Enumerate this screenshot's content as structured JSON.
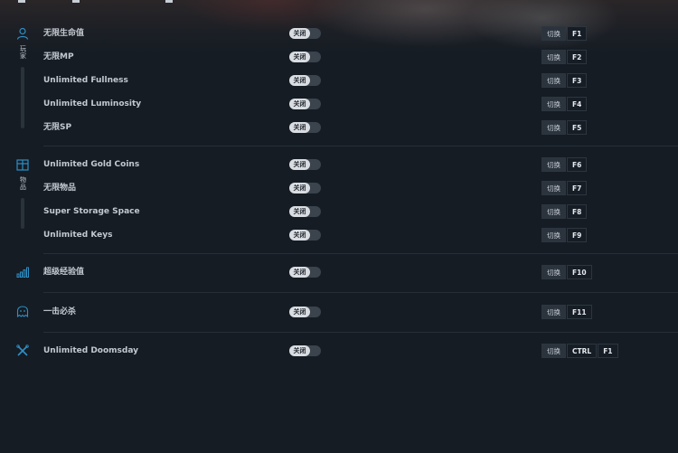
{
  "accent_color": "#2f8fc4",
  "categories": {
    "player": {
      "icon": "person-icon",
      "label": "玩家"
    },
    "inventory": {
      "icon": "box-icon",
      "label": "物品"
    },
    "stats": {
      "icon": "bars-icon"
    },
    "enemies": {
      "icon": "ghost-icon"
    },
    "other": {
      "icon": "cross-icon"
    }
  },
  "toggle_off_label": "关闭",
  "switch_label": "切换",
  "cheats": [
    {
      "name": "无限生命值",
      "keys": [
        "F1"
      ]
    },
    {
      "name": "无限MP",
      "keys": [
        "F2"
      ]
    },
    {
      "name": "Unlimited Fullness",
      "keys": [
        "F3"
      ]
    },
    {
      "name": "Unlimited Luminosity",
      "keys": [
        "F4"
      ]
    },
    {
      "name": "无限SP",
      "keys": [
        "F5"
      ]
    },
    {
      "name": "Unlimited Gold Coins",
      "keys": [
        "F6"
      ]
    },
    {
      "name": "无限物品",
      "keys": [
        "F7"
      ]
    },
    {
      "name": "Super Storage Space",
      "keys": [
        "F8"
      ]
    },
    {
      "name": "Unlimited Keys",
      "keys": [
        "F9"
      ]
    },
    {
      "name": "超级经验值",
      "keys": [
        "F10"
      ]
    },
    {
      "name": "一击必杀",
      "keys": [
        "F11"
      ]
    },
    {
      "name": "Unlimited Doomsday",
      "keys": [
        "CTRL",
        "F1"
      ]
    }
  ]
}
